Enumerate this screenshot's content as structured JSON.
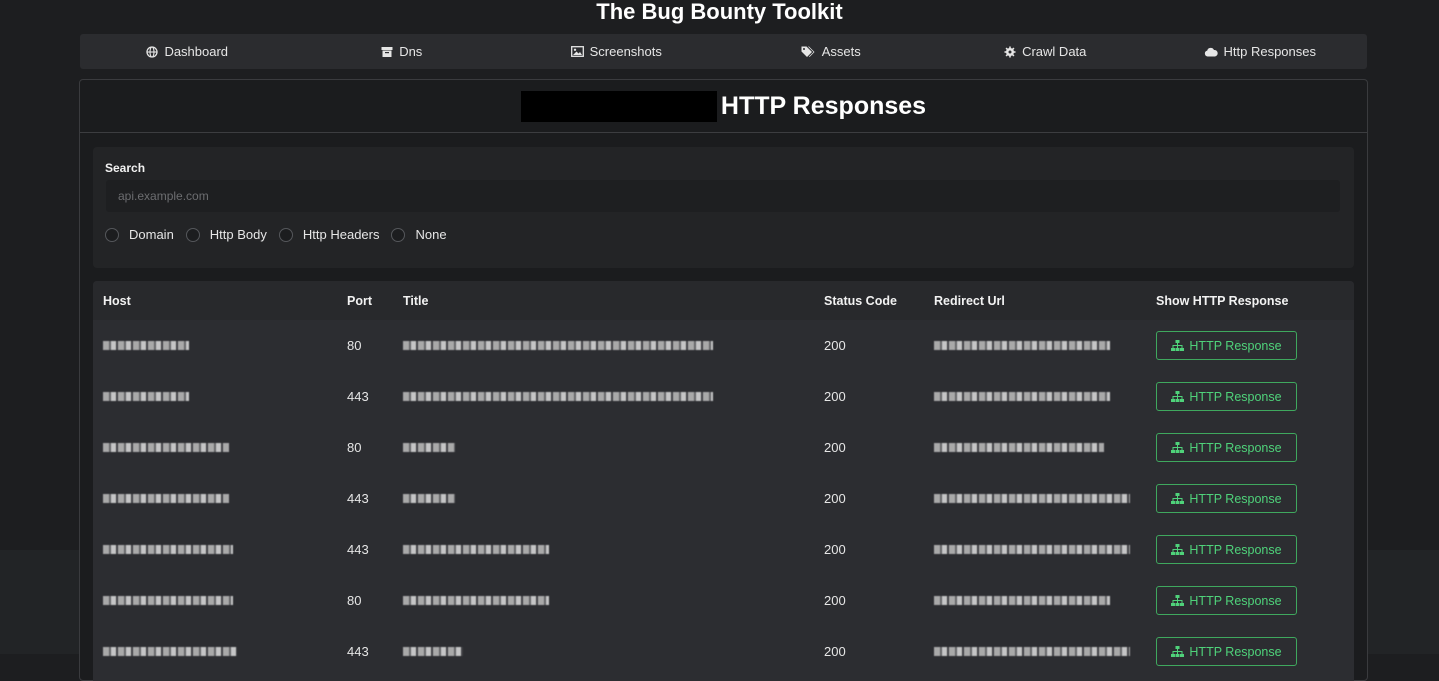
{
  "app": {
    "title": "The Bug Bounty Toolkit"
  },
  "nav": {
    "items": [
      {
        "label": "Dashboard",
        "icon": "globe-icon"
      },
      {
        "label": "Dns",
        "icon": "archive-icon"
      },
      {
        "label": "Screenshots",
        "icon": "image-icon"
      },
      {
        "label": "Assets",
        "icon": "tags-icon"
      },
      {
        "label": "Crawl Data",
        "icon": "gear-icon"
      },
      {
        "label": "Http Responses",
        "icon": "cloud-icon"
      }
    ]
  },
  "page": {
    "title": "HTTP Responses"
  },
  "search": {
    "label": "Search",
    "placeholder": "api.example.com",
    "options": [
      "Domain",
      "Http Body",
      "Http Headers",
      "None"
    ]
  },
  "table": {
    "headers": [
      "Host",
      "Port",
      "Title",
      "Status Code",
      "Redirect Url",
      "Show HTTP Response"
    ],
    "button_label": "HTTP Response",
    "rows": [
      {
        "port": "80",
        "status": "200"
      },
      {
        "port": "443",
        "status": "200"
      },
      {
        "port": "80",
        "status": "200"
      },
      {
        "port": "443",
        "status": "200"
      },
      {
        "port": "443",
        "status": "200"
      },
      {
        "port": "80",
        "status": "200"
      },
      {
        "port": "443",
        "status": "200"
      }
    ]
  },
  "colors": {
    "accent_green": "#4fd27a",
    "background": "#1d1e20"
  }
}
